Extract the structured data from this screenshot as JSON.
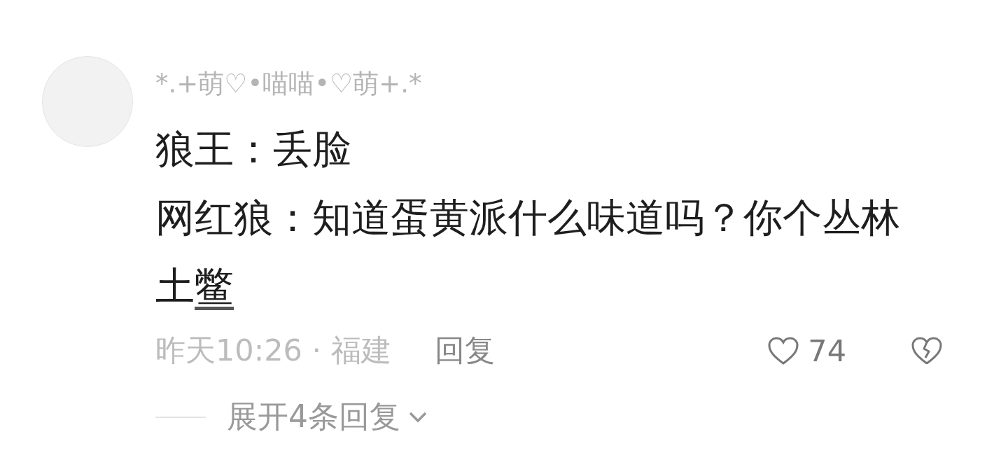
{
  "comment": {
    "username": "*.+萌♡•喵喵•♡萌+.*",
    "lines": [
      {
        "text": "狼王：丢脸"
      },
      {
        "text": "网红狼：知道蛋黄派什么味道吗？你个丛林土",
        "link": "鳖"
      }
    ],
    "time": "昨天10:26 · 福建",
    "reply": "回复",
    "likes": "74",
    "liked": false
  },
  "expand": {
    "label": "展开4条回复"
  }
}
